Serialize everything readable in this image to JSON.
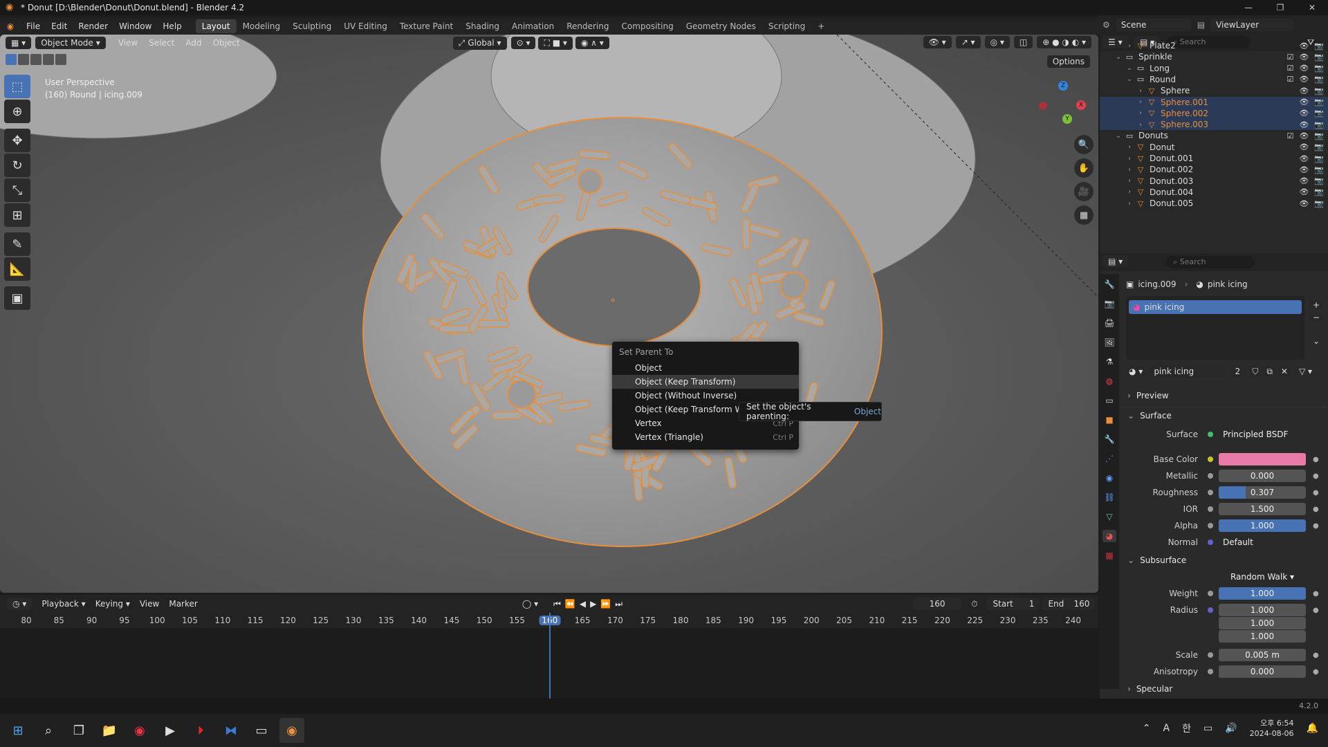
{
  "titlebar": {
    "title": "* Donut [D:\\Blender\\Donut\\Donut.blend] - Blender 4.2",
    "min": "—",
    "max": "❐",
    "close": "✕"
  },
  "menubar": {
    "menus": [
      "File",
      "Edit",
      "Render",
      "Window",
      "Help"
    ],
    "workspaces": [
      "Layout",
      "Modeling",
      "Sculpting",
      "UV Editing",
      "Texture Paint",
      "Shading",
      "Animation",
      "Rendering",
      "Compositing",
      "Geometry Nodes",
      "Scripting"
    ],
    "add": "+",
    "scene": "Scene",
    "viewlayer": "ViewLayer"
  },
  "viewport": {
    "mode": "Object Mode",
    "menus": [
      "View",
      "Select",
      "Add",
      "Object"
    ],
    "orientation": "Global",
    "options": "Options",
    "info_line1": "User Perspective",
    "info_line2": "(160) Round | icing.009",
    "gizmo": {
      "x": "X",
      "y": "Y",
      "z": "Z"
    }
  },
  "context_menu": {
    "title": "Set Parent To",
    "items": [
      {
        "label": "Object",
        "shortcut": ""
      },
      {
        "label": "Object (Keep Transform)",
        "shortcut": ""
      },
      {
        "label": "Object (Without Inverse)",
        "shortcut": ""
      },
      {
        "label": "Object (Keep Transform Without Inverse)",
        "shortcut": ""
      },
      {
        "label": "Vertex",
        "shortcut": "Ctrl P"
      },
      {
        "label": "Vertex (Triangle)",
        "shortcut": "Ctrl P"
      }
    ]
  },
  "tooltip": {
    "text": "Set the object's parenting:",
    "value": "Object"
  },
  "timeline": {
    "menus": [
      "Playback",
      "Keying",
      "View",
      "Marker"
    ],
    "current_frame": "160",
    "start_label": "Start",
    "start": "1",
    "end_label": "End",
    "end": "160",
    "ticks": [
      "80",
      "85",
      "90",
      "95",
      "100",
      "105",
      "110",
      "115",
      "120",
      "125",
      "130",
      "135",
      "140",
      "145",
      "150",
      "155",
      "160",
      "165",
      "170",
      "175",
      "180",
      "185",
      "190",
      "195",
      "200",
      "205",
      "210",
      "215",
      "220",
      "225",
      "230",
      "235",
      "240"
    ],
    "version": "4.2.0"
  },
  "outliner": {
    "search_placeholder": "Search",
    "rows": [
      {
        "name": "Plate2",
        "indent": 2,
        "type": "mesh",
        "sel": false
      },
      {
        "name": "Sprinkle",
        "indent": 1,
        "type": "collection",
        "sel": false
      },
      {
        "name": "Long",
        "indent": 2,
        "type": "collection",
        "sel": false
      },
      {
        "name": "Round",
        "indent": 2,
        "type": "collection",
        "sel": false
      },
      {
        "name": "Sphere",
        "indent": 3,
        "type": "mesh",
        "sel": false
      },
      {
        "name": "Sphere.001",
        "indent": 3,
        "type": "mesh",
        "sel": true
      },
      {
        "name": "Sphere.002",
        "indent": 3,
        "type": "mesh",
        "sel": true
      },
      {
        "name": "Sphere.003",
        "indent": 3,
        "type": "mesh",
        "sel": true
      },
      {
        "name": "Donuts",
        "indent": 1,
        "type": "collection",
        "sel": false
      },
      {
        "name": "Donut",
        "indent": 2,
        "type": "mesh",
        "sel": false
      },
      {
        "name": "Donut.001",
        "indent": 2,
        "type": "mesh",
        "sel": false
      },
      {
        "name": "Donut.002",
        "indent": 2,
        "type": "mesh",
        "sel": false
      },
      {
        "name": "Donut.003",
        "indent": 2,
        "type": "mesh",
        "sel": false
      },
      {
        "name": "Donut.004",
        "indent": 2,
        "type": "mesh",
        "sel": false
      },
      {
        "name": "Donut.005",
        "indent": 2,
        "type": "mesh",
        "sel": false
      }
    ]
  },
  "properties": {
    "search_placeholder": "Search",
    "breadcrumb_object": "icing.009",
    "breadcrumb_material": "pink icing",
    "slot": "pink icing",
    "material_name": "pink icing",
    "users": "2",
    "preview": "Preview",
    "surface": "Surface",
    "surface_shader_label": "Surface",
    "surface_shader": "Principled BSDF",
    "base_color_label": "Base Color",
    "base_color": "#e77aa7",
    "metallic_label": "Metallic",
    "metallic": "0.000",
    "roughness_label": "Roughness",
    "roughness": "0.307",
    "roughness_frac": 0.307,
    "ior_label": "IOR",
    "ior": "1.500",
    "alpha_label": "Alpha",
    "alpha": "1.000",
    "alpha_frac": 1.0,
    "normal_label": "Normal",
    "normal": "Default",
    "subsurface": "Subsurface",
    "subsurface_method": "Random Walk",
    "weight_label": "Weight",
    "weight": "1.000",
    "weight_frac": 1.0,
    "radius_label": "Radius",
    "radius": [
      "1.000",
      "1.000",
      "1.000"
    ],
    "scale_label": "Scale",
    "scale": "0.005 m",
    "anisotropy_label": "Anisotropy",
    "anisotropy": "0.000",
    "specular": "Specular"
  },
  "taskbar": {
    "time": "오후 6:54",
    "date": "2024-08-06",
    "lang": "A",
    "ime": "한"
  }
}
